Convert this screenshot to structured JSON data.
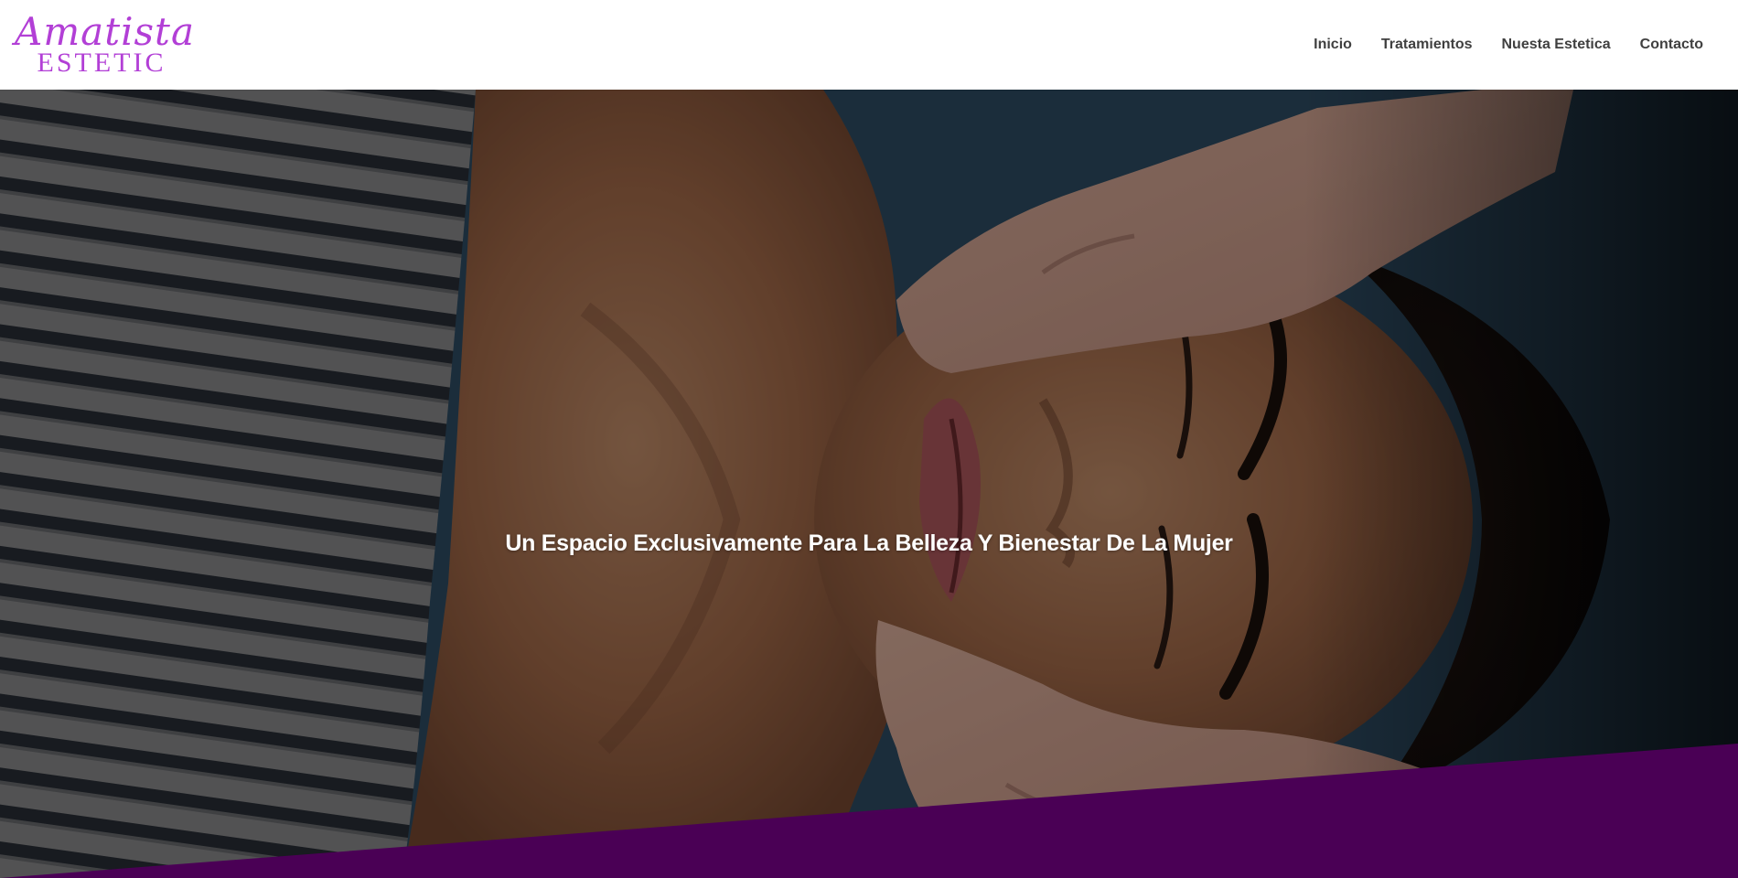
{
  "brand": {
    "script_name": "Amatista",
    "caps_name": "ESTETIC",
    "color": "#b23fd6"
  },
  "nav": {
    "items": [
      {
        "label": "Inicio"
      },
      {
        "label": "Tratamientos"
      },
      {
        "label": "Nuesta Estetica"
      },
      {
        "label": "Contacto"
      }
    ]
  },
  "hero": {
    "title": "Un Espacio Exclusivamente Para La Belleza Y Bienestar De La Mujer",
    "image_subject": "woman-receiving-facial-massage",
    "overlay_color": "#000000",
    "divider_color": "#4a0055"
  }
}
